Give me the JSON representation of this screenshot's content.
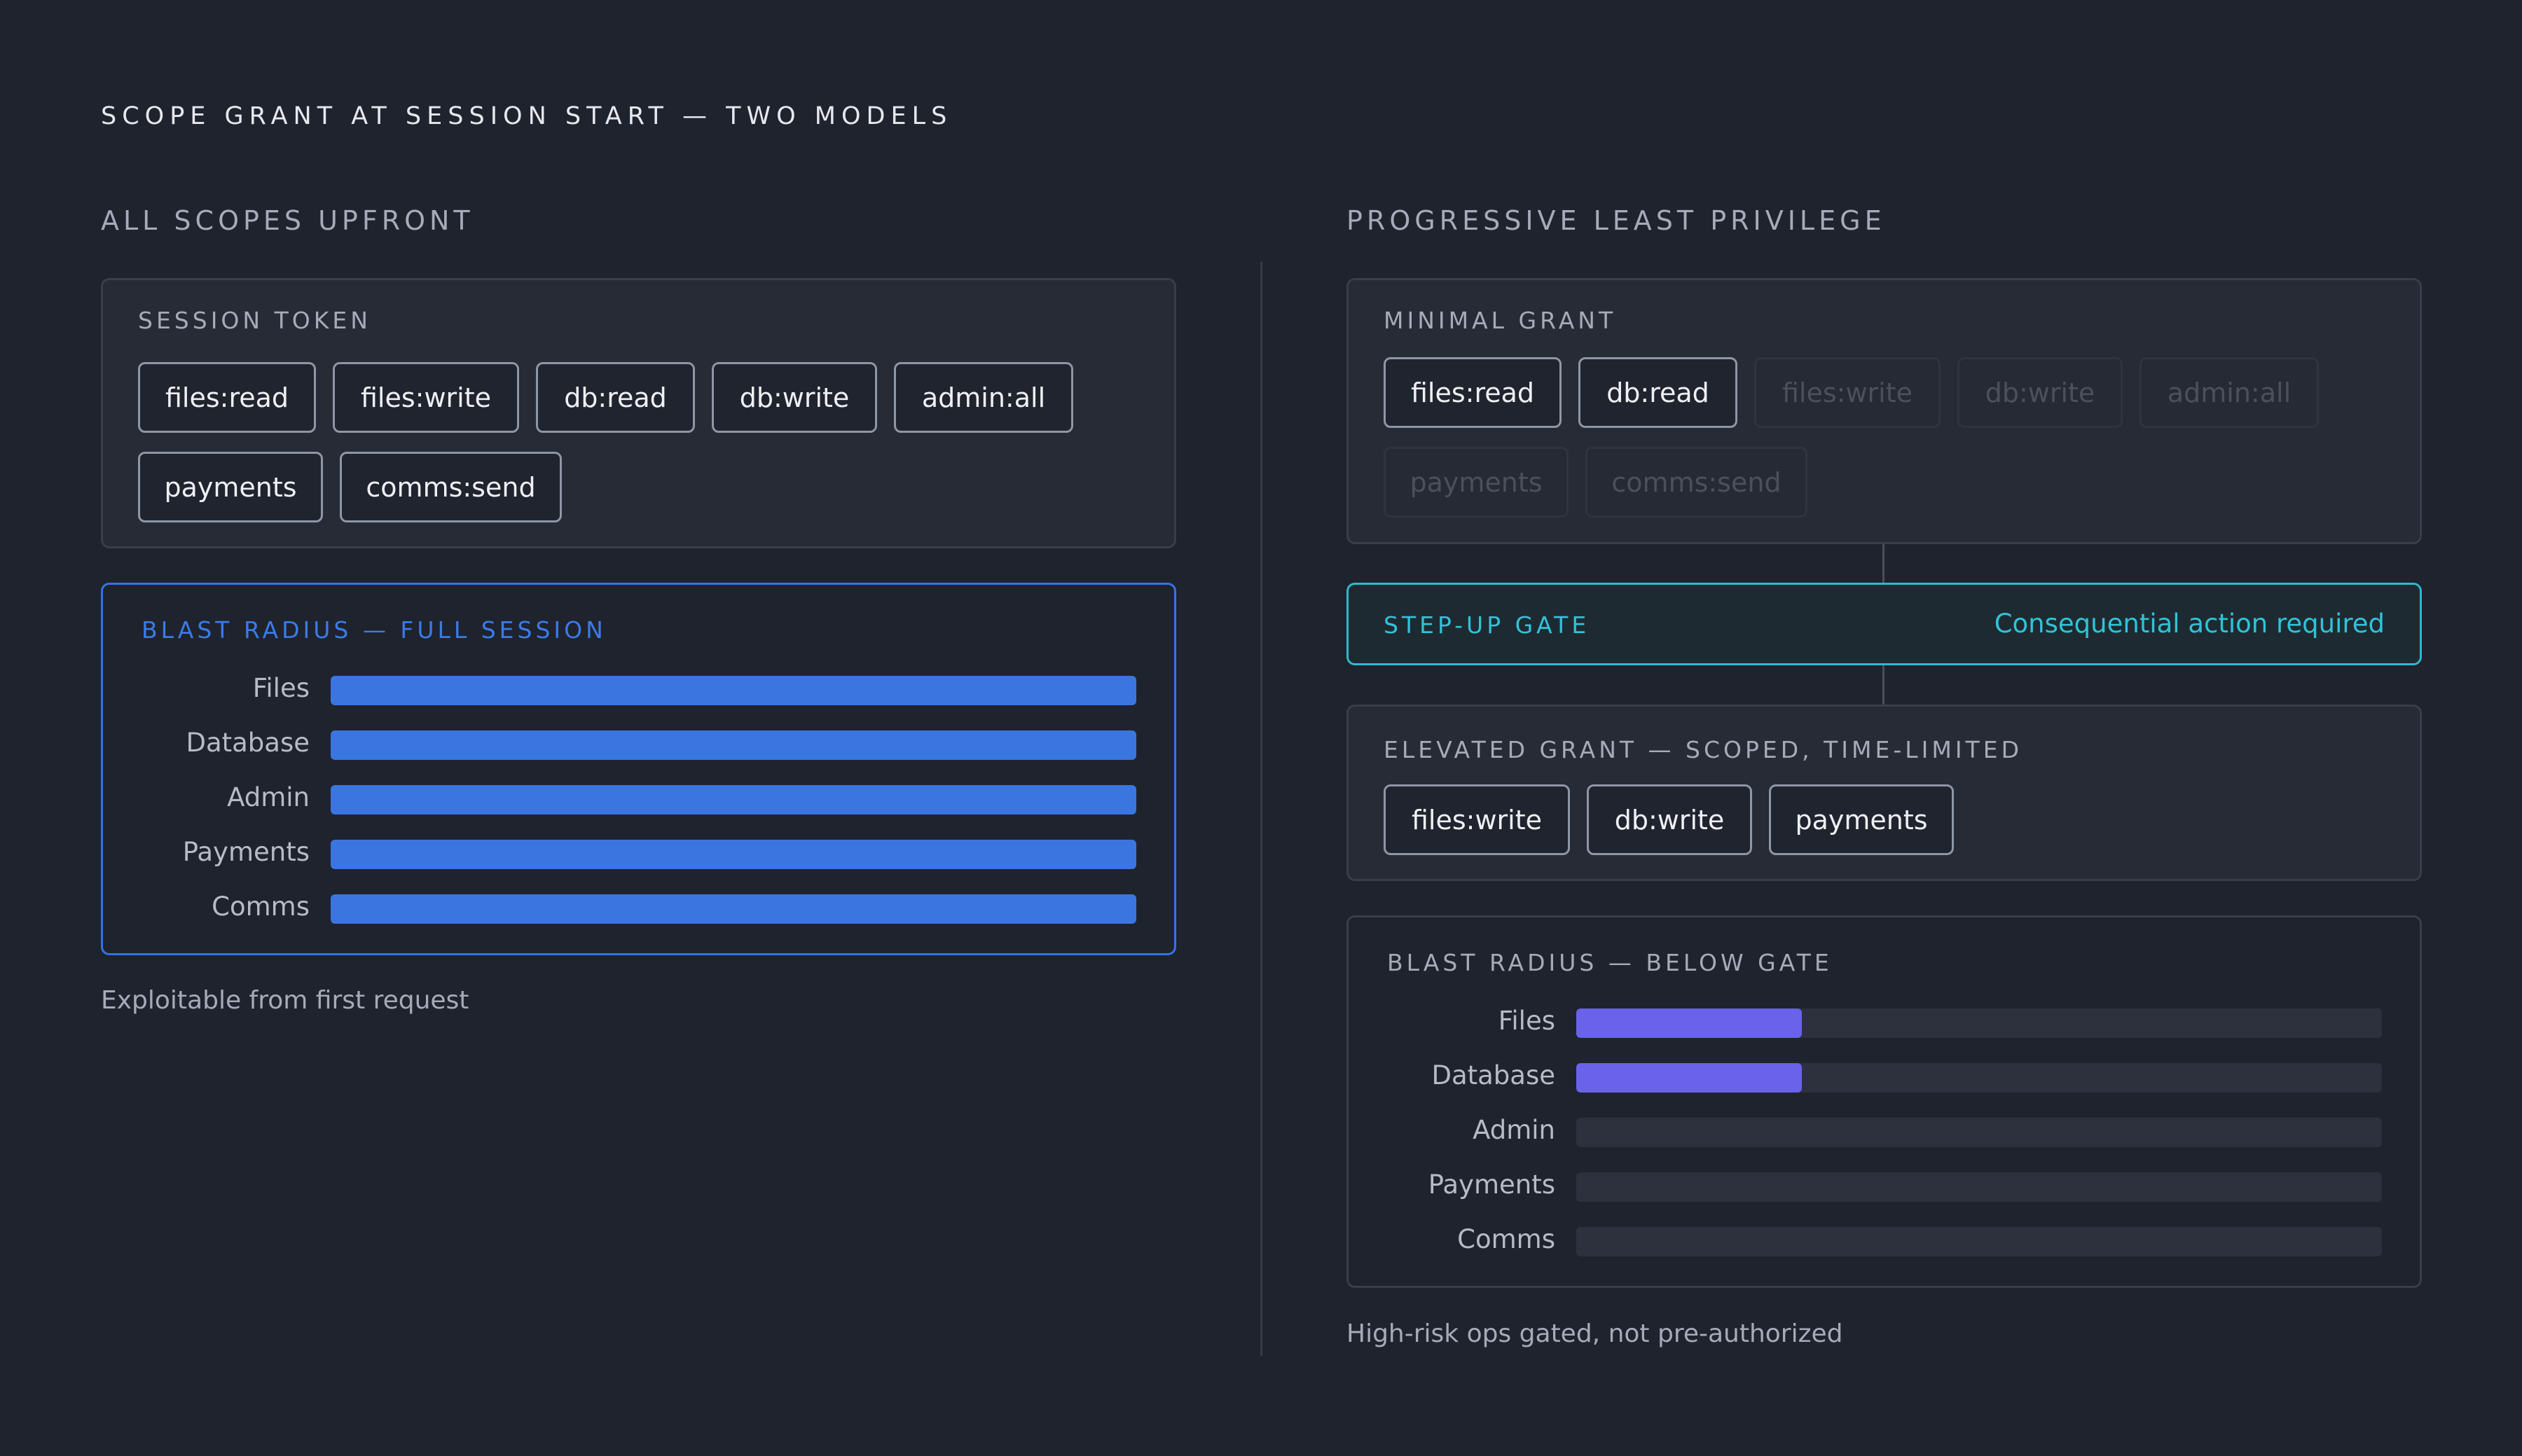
{
  "title": "SCOPE GRANT AT SESSION START — TWO MODELS",
  "colors": {
    "full_fill": "#3b76e0",
    "below_gate_fill": "#6a62ea",
    "blast_border": "#3473e6",
    "gate_accent": "#2fb8cf"
  },
  "left": {
    "heading": "ALL SCOPES UPFRONT",
    "token_card": {
      "label": "SESSION TOKEN",
      "scopes": [
        "files:read",
        "files:write",
        "db:read",
        "db:write",
        "admin:all",
        "payments",
        "comms:send"
      ]
    },
    "blast": {
      "title": "BLAST RADIUS — FULL SESSION",
      "bars": [
        {
          "label": "Files",
          "fraction": 1.0
        },
        {
          "label": "Database",
          "fraction": 1.0
        },
        {
          "label": "Admin",
          "fraction": 1.0
        },
        {
          "label": "Payments",
          "fraction": 1.0
        },
        {
          "label": "Comms",
          "fraction": 1.0
        }
      ]
    },
    "footnote": "Exploitable from first request"
  },
  "right": {
    "heading": "PROGRESSIVE LEAST PRIVILEGE",
    "minimal_card": {
      "label": "MINIMAL GRANT",
      "scopes": [
        {
          "name": "files:read",
          "granted": true
        },
        {
          "name": "db:read",
          "granted": true
        },
        {
          "name": "files:write",
          "granted": false
        },
        {
          "name": "db:write",
          "granted": false
        },
        {
          "name": "admin:all",
          "granted": false
        },
        {
          "name": "payments",
          "granted": false
        },
        {
          "name": "comms:send",
          "granted": false
        }
      ]
    },
    "gate": {
      "label": "STEP-UP GATE",
      "note": "Consequential action required"
    },
    "elevated_card": {
      "label": "ELEVATED GRANT — SCOPED, TIME-LIMITED",
      "scopes": [
        "files:write",
        "db:write",
        "payments"
      ]
    },
    "blast": {
      "title": "BLAST RADIUS — BELOW GATE",
      "bars": [
        {
          "label": "Files",
          "fraction": 0.28
        },
        {
          "label": "Database",
          "fraction": 0.28
        },
        {
          "label": "Admin",
          "fraction": 0
        },
        {
          "label": "Payments",
          "fraction": 0
        },
        {
          "label": "Comms",
          "fraction": 0
        }
      ]
    },
    "footnote": "High-risk ops gated, not pre-authorized"
  }
}
